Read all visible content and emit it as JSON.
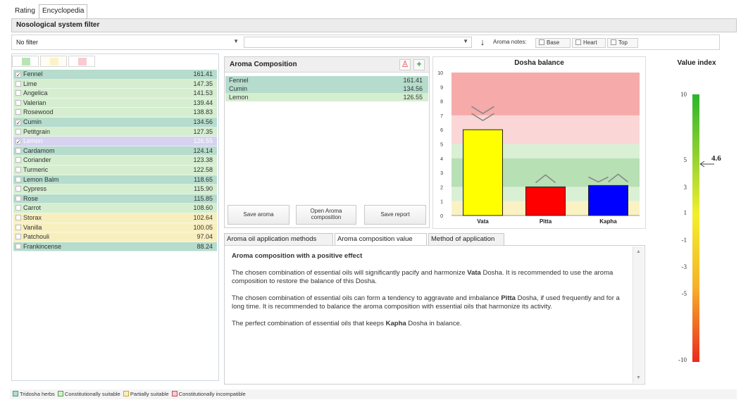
{
  "top_tabs": [
    {
      "label": "Rating"
    },
    {
      "label": "Encyclopedia"
    }
  ],
  "nosological_filter_title": "Nosological system filter",
  "filters": {
    "primary_value": "No filter",
    "secondary_value": "",
    "aroma_notes_label": "Aroma notes:",
    "notes": [
      "Base",
      "Heart",
      "Top"
    ]
  },
  "colors": {
    "green": "#b5dccc",
    "light_green": "#d5eed0",
    "yellow": "#f8efbf",
    "pink": "#f8cbd0",
    "selected": "#d6d2f0"
  },
  "oils": [
    {
      "name": "Fennel",
      "value": "161.41",
      "checked": true,
      "category": "g1"
    },
    {
      "name": "Lime",
      "value": "147.35",
      "checked": false,
      "category": "g2"
    },
    {
      "name": "Angelica",
      "value": "141.53",
      "checked": false,
      "category": "g2"
    },
    {
      "name": "Valerian",
      "value": "139.44",
      "checked": false,
      "category": "g2"
    },
    {
      "name": "Rosewood",
      "value": "138.83",
      "checked": false,
      "category": "g2"
    },
    {
      "name": "Cumin",
      "value": "134.56",
      "checked": true,
      "category": "g1"
    },
    {
      "name": "Petitgrain",
      "value": "127.35",
      "checked": false,
      "category": "g2"
    },
    {
      "name": "Lemon",
      "value": "126.55",
      "checked": true,
      "category": "sel"
    },
    {
      "name": "Cardamom",
      "value": "124.14",
      "checked": false,
      "category": "g1"
    },
    {
      "name": "Coriander",
      "value": "123.38",
      "checked": false,
      "category": "g2"
    },
    {
      "name": "Turmeric",
      "value": "122.58",
      "checked": false,
      "category": "g2"
    },
    {
      "name": "Lemon Balm",
      "value": "118.65",
      "checked": false,
      "category": "g1"
    },
    {
      "name": "Cypress",
      "value": "115.90",
      "checked": false,
      "category": "g2"
    },
    {
      "name": "Rose",
      "value": "115.85",
      "checked": false,
      "category": "g1"
    },
    {
      "name": "Carrot",
      "value": "108.60",
      "checked": false,
      "category": "g2"
    },
    {
      "name": "Storax",
      "value": "102.64",
      "checked": false,
      "category": "y1"
    },
    {
      "name": "Vanilla",
      "value": "100.05",
      "checked": false,
      "category": "y1"
    },
    {
      "name": "Patchouli",
      "value": "97.04",
      "checked": false,
      "category": "y1"
    },
    {
      "name": "Frankincense",
      "value": "88.24",
      "checked": false,
      "category": "g1"
    }
  ],
  "aroma_composition": {
    "title": "Aroma Composition",
    "items": [
      {
        "name": "Fennel",
        "value": "161.41",
        "category": "g1"
      },
      {
        "name": "Cumin",
        "value": "134.56",
        "category": "g1"
      },
      {
        "name": "Lemon",
        "value": "126.55",
        "category": "g2"
      }
    ],
    "save_aroma_label": "Save aroma",
    "open_composition_label": "Open Aroma composition",
    "save_report_label": "Save report"
  },
  "chart_data": {
    "type": "bar",
    "title": "Dosha balance",
    "categories": [
      "Vata",
      "Pitta",
      "Kapha"
    ],
    "values": [
      6.0,
      2.0,
      2.1
    ],
    "colors": [
      "#ffff00",
      "#ff0000",
      "#0000ff"
    ],
    "arrows": [
      "down-double",
      "up",
      "up-double-pair"
    ],
    "ylim": [
      0,
      10
    ],
    "yticks": [
      0,
      1,
      2,
      3,
      4,
      5,
      6,
      7,
      8,
      9,
      10
    ],
    "bands": [
      {
        "from": 7,
        "to": 10,
        "color": "#f6aaaa"
      },
      {
        "from": 5,
        "to": 7,
        "color": "#fbd6d6"
      },
      {
        "from": 4,
        "to": 5,
        "color": "#d9f0d5"
      },
      {
        "from": 2,
        "to": 4,
        "color": "#b8e0b5"
      },
      {
        "from": 1,
        "to": 2,
        "color": "#d9f0d5"
      },
      {
        "from": 0,
        "to": 1,
        "color": "#fbf2c4"
      }
    ]
  },
  "value_index": {
    "title": "Value index",
    "value": "4.6",
    "ticks": [
      "10",
      "5",
      "3",
      "1",
      "-1",
      "-3",
      "-5",
      "-10"
    ]
  },
  "tabs": [
    {
      "label": "Aroma oil application methods"
    },
    {
      "label": "Aroma composition value"
    },
    {
      "label": "Method of application"
    }
  ],
  "description": {
    "heading": "Aroma composition with a positive effect",
    "p1_a": "The chosen combination of essential oils will significantly pacify and harmonize ",
    "p1_b": "Vata",
    "p1_c": " Dosha. It is recommended to use the aroma composition to restore the balance of this Dosha.",
    "p2_a": "The chosen combination of essential oils can form a tendency to aggravate and imbalance ",
    "p2_b": "Pitta",
    "p2_c": " Dosha, if used frequently and for a long time. It is recommended to balance the aroma composition with essential oils that harmonize its activity.",
    "p3_a": "The perfect combination of essential oils that keeps ",
    "p3_b": "Kapha",
    "p3_c": " Dosha in balance."
  },
  "legend": [
    {
      "label": "Tridosha herbs",
      "color": "#b5dccc",
      "border": "#4b9b7a"
    },
    {
      "label": "Constitutionally suitable",
      "color": "#d5eed0",
      "border": "#5a9d4f"
    },
    {
      "label": "Partially suitable",
      "color": "#f8efbf",
      "border": "#c9a93b"
    },
    {
      "label": "Constitutionally incompatible",
      "color": "#f8cbd0",
      "border": "#c0505c"
    }
  ]
}
